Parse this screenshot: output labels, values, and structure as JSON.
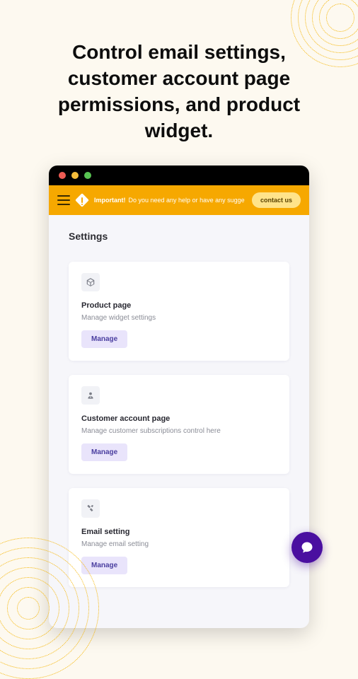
{
  "headline": "Control email settings, customer account page permissions, and product widget.",
  "banner": {
    "strong": "Important!",
    "text": "Do you need any help or have any suggestion?",
    "cta": "contact us"
  },
  "content": {
    "title": "Settings",
    "cards": [
      {
        "title": "Product page",
        "desc": "Manage widget settings",
        "btn": "Manage",
        "icon": "cube-icon"
      },
      {
        "title": "Customer account page",
        "desc": "Manage customer subscriptions control here",
        "btn": "Manage",
        "icon": "user-icon"
      },
      {
        "title": "Email setting",
        "desc": "Manage email setting",
        "btn": "Manage",
        "icon": "tools-icon"
      }
    ]
  },
  "colors": {
    "accent": "#f6a800",
    "brand": "#4a0fa0"
  }
}
